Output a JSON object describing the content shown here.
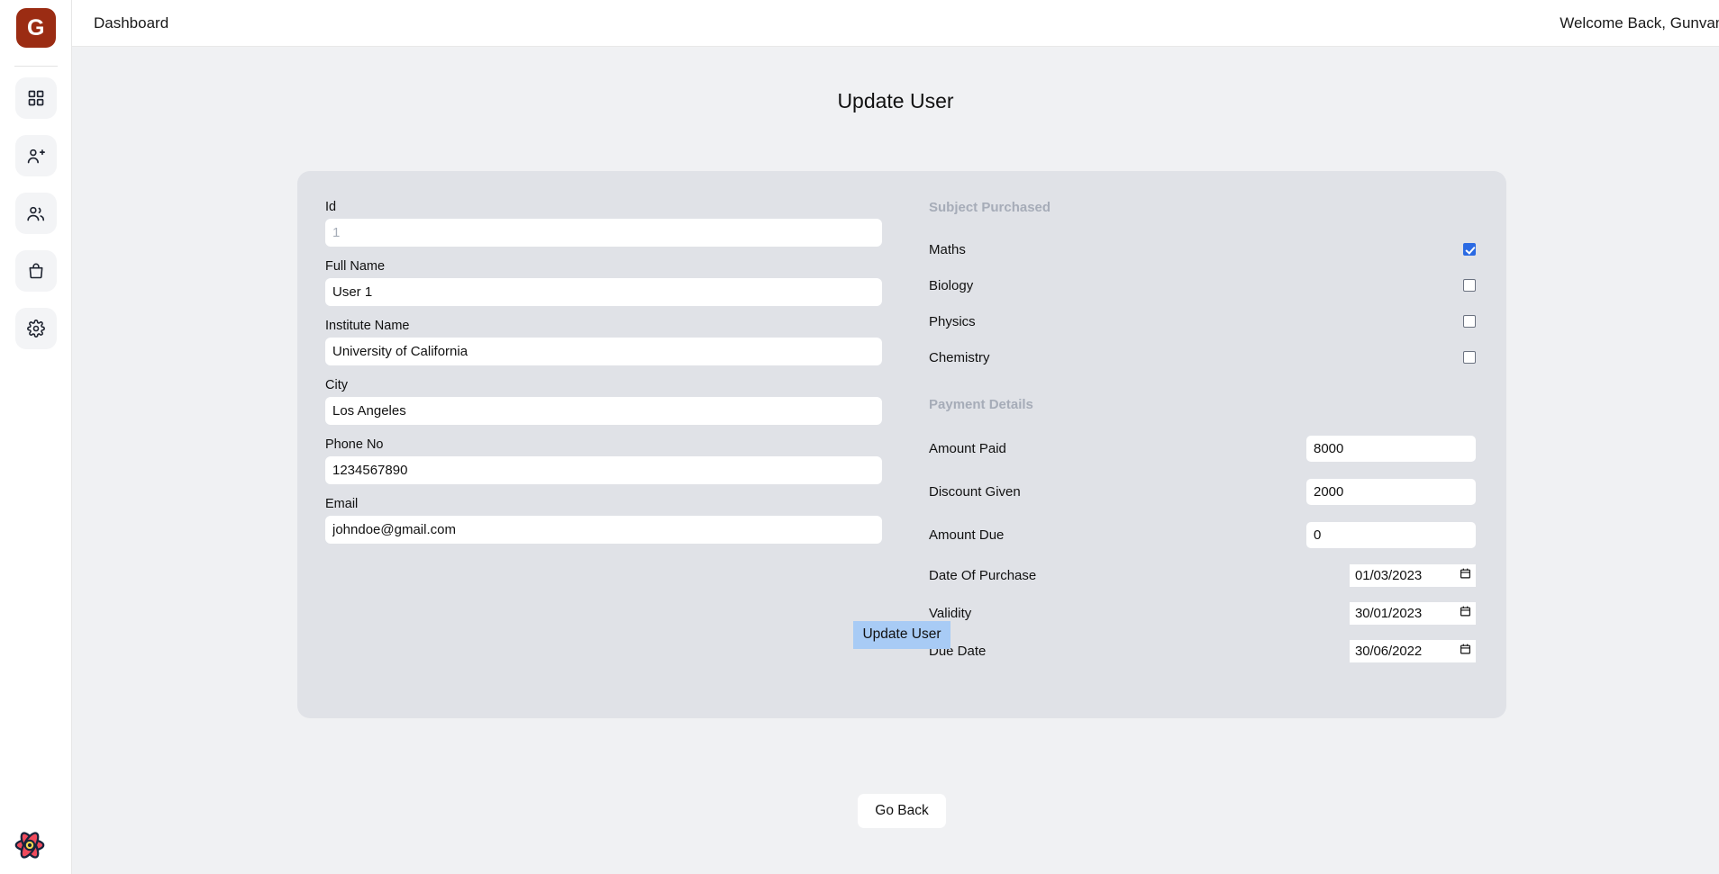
{
  "sidebar": {
    "logo_text": "G",
    "items": [
      {
        "icon": "grid-icon",
        "name": "dashboard"
      },
      {
        "icon": "user-plus-icon",
        "name": "add-user"
      },
      {
        "icon": "users-icon",
        "name": "users"
      },
      {
        "icon": "shopping-bag-icon",
        "name": "purchases"
      },
      {
        "icon": "gear-icon",
        "name": "settings"
      }
    ],
    "devtools_icon": "react-query-devtools-icon"
  },
  "topbar": {
    "title": "Dashboard",
    "welcome": "Welcome Back, Gunvant"
  },
  "page": {
    "title": "Update User"
  },
  "form": {
    "left_fields": [
      {
        "label": "Id",
        "value": "",
        "placeholder": "1"
      },
      {
        "label": "Full Name",
        "value": "User 1",
        "placeholder": ""
      },
      {
        "label": "Institute Name",
        "value": "University of California",
        "placeholder": ""
      },
      {
        "label": "City",
        "value": "Los Angeles",
        "placeholder": ""
      },
      {
        "label": "Phone No",
        "value": "1234567890",
        "placeholder": ""
      },
      {
        "label": "Email",
        "value": "johndoe@gmail.com",
        "placeholder": ""
      }
    ],
    "subject_section": {
      "heading": "Subject Purchased",
      "subjects": [
        {
          "label": "Maths",
          "checked": true
        },
        {
          "label": "Biology",
          "checked": false
        },
        {
          "label": "Physics",
          "checked": false
        },
        {
          "label": "Chemistry",
          "checked": false
        }
      ]
    },
    "payment_section": {
      "heading": "Payment Details",
      "amounts": [
        {
          "label": "Amount Paid",
          "value": "8000"
        },
        {
          "label": "Discount Given",
          "value": "2000"
        },
        {
          "label": "Amount Due",
          "value": "0"
        }
      ],
      "dates": [
        {
          "label": "Date Of Purchase",
          "value": "01/03/2023"
        },
        {
          "label": "Validity",
          "value": "30/01/2023"
        },
        {
          "label": "Due Date",
          "value": "30/06/2022"
        }
      ]
    },
    "submit_label": "Update User",
    "go_back_label": "Go Back"
  },
  "colors": {
    "logo_bg": "#9b2c13",
    "card_bg": "#e0e2e7",
    "page_bg": "#f0f1f3",
    "checkbox_checked": "#2b6ae3",
    "submit_selection": "#a8cbf5"
  }
}
